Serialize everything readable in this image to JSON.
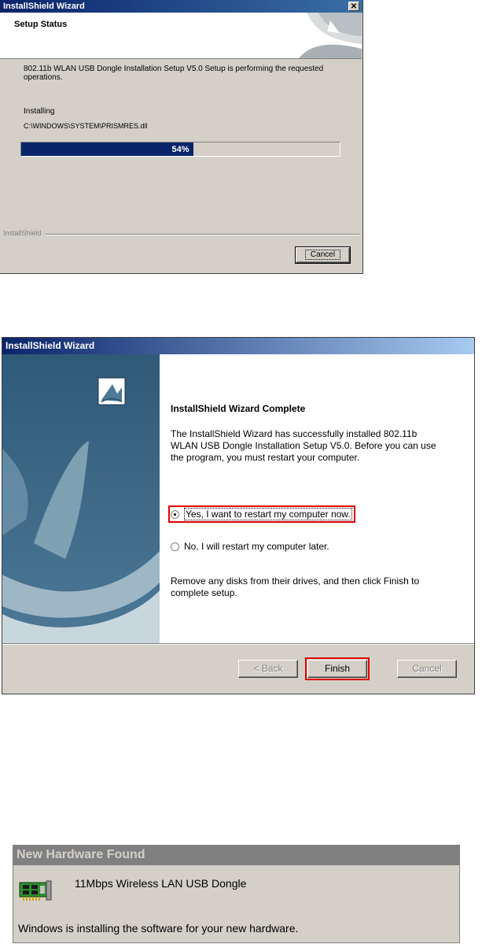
{
  "setup_status": {
    "window_title": "InstallShield Wizard",
    "close_glyph": "✕",
    "header_title": "Setup Status",
    "message": "802.11b WLAN USB Dongle Installation Setup V5.0 Setup is performing the requested operations.",
    "action_label": "Installing",
    "file_path": "C:\\WINDOWS\\SYSTEM\\PRISMRES.dll",
    "progress_percent": 54,
    "progress_text": "54%",
    "brand": "InstallShield",
    "cancel_label": "Cancel"
  },
  "wizard_complete": {
    "window_title": "InstallShield Wizard",
    "heading": "InstallShield Wizard Complete",
    "body": "The InstallShield Wizard has successfully installed 802.11b WLAN USB Dongle Installation Setup V5.0.  Before you can use the program, you must restart your computer.",
    "option_yes": "Yes, I want to restart my computer now.",
    "option_no": "No, I will restart my computer later.",
    "selected_option": "option_yes",
    "remove_text": "Remove any disks from their drives, and then click Finish to complete setup.",
    "back_label": "< Back",
    "finish_label": "Finish",
    "cancel_label": "Cancel",
    "highlight_color": "#e00000"
  },
  "new_hardware": {
    "window_title": "New Hardware Found",
    "device_name": "11Mbps Wireless LAN USB Dongle",
    "status_text": "Windows is installing the software for your new hardware.",
    "icon": "network-card-icon"
  }
}
